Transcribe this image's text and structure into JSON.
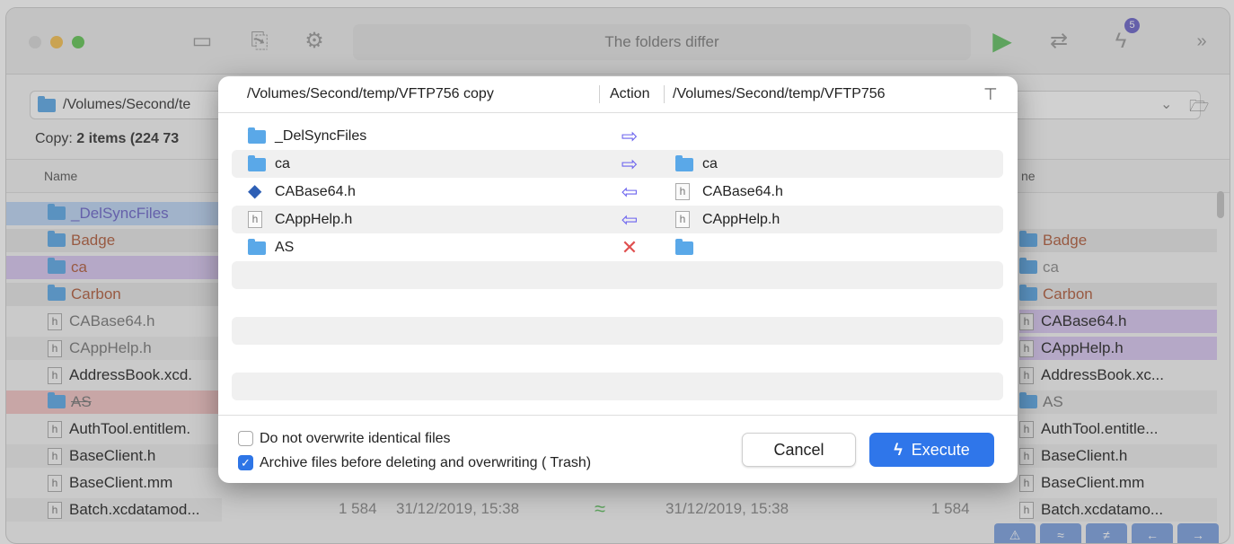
{
  "toolbar": {
    "status_text": "The folders differ",
    "badge_count": "5",
    "icons": [
      "new-folder-icon",
      "inspect-file-icon",
      "gear-icon",
      "play-icon",
      "sync-icon",
      "lightning-icon",
      "chevron-double-right-icon"
    ]
  },
  "left_pane": {
    "path": "/Volumes/Second/te",
    "copy_info_prefix": "Copy: ",
    "copy_info_count": "2",
    "copy_info_suffix": " items (224 73",
    "column_name": "Name",
    "rows": [
      {
        "name": "_DelSyncFiles",
        "kind": "folder",
        "color": "#6a63c9"
      },
      {
        "name": "Badge",
        "kind": "folder",
        "color": "#b05a3a"
      },
      {
        "name": "ca",
        "kind": "folder",
        "color": "#b05a3a"
      },
      {
        "name": "Carbon",
        "kind": "folder",
        "color": "#b05a3a"
      },
      {
        "name": "CABase64.h",
        "kind": "file",
        "color": "#777777"
      },
      {
        "name": "CAppHelp.h",
        "kind": "file",
        "color": "#777777"
      },
      {
        "name": "AddressBook.xcd.",
        "kind": "file",
        "color": "#222222"
      },
      {
        "name": "AS",
        "kind": "folder",
        "color": "#777777"
      },
      {
        "name": "AuthTool.entitlem.",
        "kind": "file",
        "color": "#222222"
      },
      {
        "name": "BaseClient.h",
        "kind": "file",
        "color": "#222222"
      },
      {
        "name": "BaseClient.mm",
        "kind": "file",
        "color": "#222222"
      },
      {
        "name": "Batch.xcdatamod...",
        "kind": "file",
        "color": "#222222"
      }
    ]
  },
  "right_pane": {
    "column_name": "ne",
    "rows": [
      {
        "name": "Badge",
        "kind": "folder",
        "color": "#b05a3a"
      },
      {
        "name": "ca",
        "kind": "folder",
        "color": "#8a8a8a"
      },
      {
        "name": "Carbon",
        "kind": "folder",
        "color": "#b05a3a"
      },
      {
        "name": "CABase64.h",
        "kind": "file",
        "color": "#222222"
      },
      {
        "name": "CAppHelp.h",
        "kind": "file",
        "color": "#222222"
      },
      {
        "name": "AddressBook.xc...",
        "kind": "file",
        "color": "#222222"
      },
      {
        "name": "AS",
        "kind": "folder",
        "color": "#777777"
      },
      {
        "name": "AuthTool.entitle...",
        "kind": "file",
        "color": "#222222"
      },
      {
        "name": "BaseClient.h",
        "kind": "file",
        "color": "#222222"
      },
      {
        "name": "BaseClient.mm",
        "kind": "file",
        "color": "#222222"
      },
      {
        "name": "Batch.xcdatamo...",
        "kind": "file",
        "color": "#222222"
      }
    ]
  },
  "bottom_row": {
    "left_size": "1 584",
    "left_date": "31/12/2019, 15:38",
    "right_date": "31/12/2019, 15:38",
    "right_size": "1 584"
  },
  "dialog": {
    "left_path": "/Volumes/Second/temp/VFTP756 copy",
    "action_header": "Action",
    "right_path": "/Volumes/Second/temp/VFTP756",
    "rows": [
      {
        "left": "_DelSyncFiles",
        "left_kind": "folder",
        "action": "⇨",
        "action_color": "#6b63ee",
        "right": "",
        "right_kind": "none"
      },
      {
        "left": "ca",
        "left_kind": "folder",
        "action": "⇨",
        "action_color": "#6b63ee",
        "right": "ca",
        "right_kind": "folder"
      },
      {
        "left": "CABase64.h",
        "left_kind": "gem",
        "action": "⇦",
        "action_color": "#6b63ee",
        "right": "CABase64.h",
        "right_kind": "h"
      },
      {
        "left": "CAppHelp.h",
        "left_kind": "h",
        "action": "⇦",
        "action_color": "#6b63ee",
        "right": "CAppHelp.h",
        "right_kind": "h"
      },
      {
        "left": "AS",
        "left_kind": "folder",
        "action": "✕",
        "action_color": "#e05050",
        "right": "",
        "right_kind": "folder"
      }
    ],
    "checkbox_identical": {
      "label": "Do not overwrite identical files",
      "checked": false
    },
    "checkbox_archive": {
      "label": "Archive files before deleting and overwriting ( Trash)",
      "checked": true
    },
    "cancel_label": "Cancel",
    "execute_label": "Execute"
  }
}
